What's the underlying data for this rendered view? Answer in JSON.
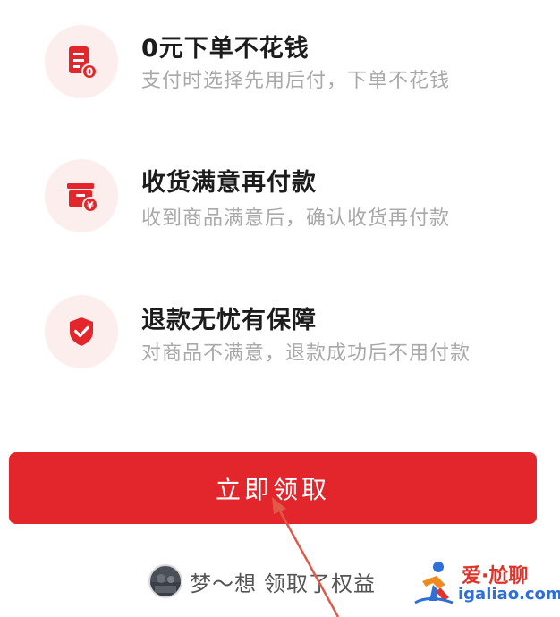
{
  "features": [
    {
      "title": "0元下单不花钱",
      "desc": "支付时选择先用后付，下单不花钱",
      "icon": "order-zero-icon",
      "badge": "0"
    },
    {
      "title": "收货满意再付款",
      "desc": "收到商品满意后，确认收货再付款",
      "icon": "box-yen-icon",
      "badge": "¥"
    },
    {
      "title": "退款无忧有保障",
      "desc": "对商品不满意，退款成功后不用付款",
      "icon": "shield-check-icon"
    }
  ],
  "button": {
    "label": "立即领取"
  },
  "footer": {
    "username": "梦～想",
    "action": "领取了权益"
  },
  "watermark": {
    "cn": "爱·尬聊",
    "url": "igaliao.com"
  },
  "colors": {
    "accent": "#e3262b",
    "icon_bg": "#fdeeee",
    "title": "#1c1c1c",
    "desc": "#a9a9a9",
    "annotation_arrow": "#e05a4a"
  }
}
